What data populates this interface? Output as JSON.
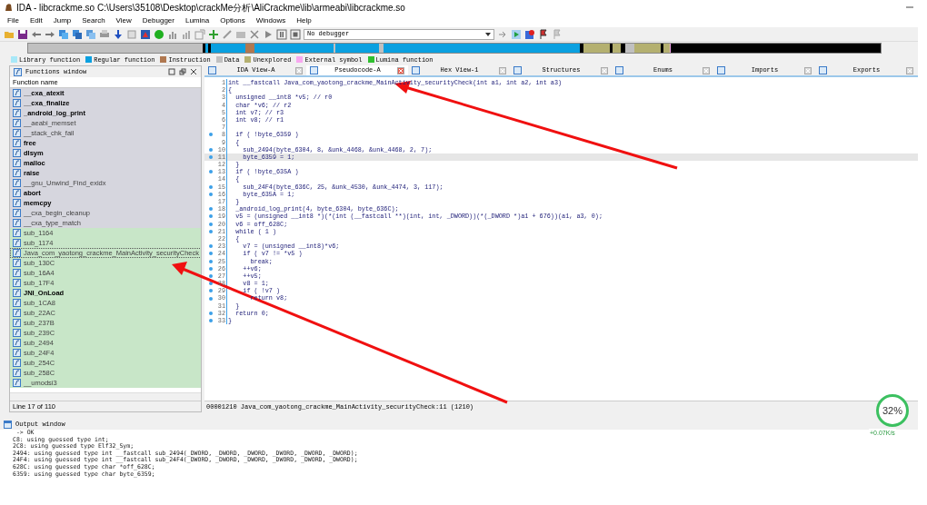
{
  "window": {
    "title": "IDA - libcrackme.so C:\\Users\\35108\\Desktop\\crackMe分析\\AliCrackme\\lib\\armeabi\\libcrackme.so"
  },
  "menu": [
    "File",
    "Edit",
    "Jump",
    "Search",
    "View",
    "Debugger",
    "Lumina",
    "Options",
    "Windows",
    "Help"
  ],
  "toolbar": {
    "debugger_select": "No debugger"
  },
  "legend": [
    {
      "label": "Library function",
      "color": "#a8e8f8"
    },
    {
      "label": "Regular function",
      "color": "#0aa0e0"
    },
    {
      "label": "Instruction",
      "color": "#b07850"
    },
    {
      "label": "Data",
      "color": "#c0c0c0"
    },
    {
      "label": "Unexplored",
      "color": "#b4b070"
    },
    {
      "label": "External symbol",
      "color": "#f8a8f0"
    },
    {
      "label": "Lumina function",
      "color": "#30c030"
    }
  ],
  "functions_window": {
    "title": "Functions window",
    "column": "Function name",
    "status": "Line 17 of 110",
    "items": [
      {
        "name": "__cxa_atexit",
        "bold": true,
        "color": "#d6d6de",
        "selected": false
      },
      {
        "name": "__cxa_finalize",
        "bold": true,
        "color": "#d6d6de",
        "selected": false
      },
      {
        "name": "_android_log_print",
        "bold": true,
        "color": "#d6d6de",
        "selected": false
      },
      {
        "name": "__aeabi_memset",
        "bold": false,
        "color": "#d6d6de",
        "selected": false
      },
      {
        "name": "__stack_chk_fail",
        "bold": false,
        "color": "#d6d6de",
        "selected": false
      },
      {
        "name": "free",
        "bold": true,
        "color": "#d6d6de",
        "selected": false
      },
      {
        "name": "dlsym",
        "bold": true,
        "color": "#d6d6de",
        "selected": false
      },
      {
        "name": "malloc",
        "bold": true,
        "color": "#d6d6de",
        "selected": false
      },
      {
        "name": "raise",
        "bold": true,
        "color": "#d6d6de",
        "selected": false
      },
      {
        "name": "__gnu_Unwind_Find_exidx",
        "bold": false,
        "color": "#d6d6de",
        "selected": false
      },
      {
        "name": "abort",
        "bold": true,
        "color": "#d6d6de",
        "selected": false
      },
      {
        "name": "memcpy",
        "bold": true,
        "color": "#d6d6de",
        "selected": false
      },
      {
        "name": "__cxa_begin_cleanup",
        "bold": false,
        "color": "#d6d6de",
        "selected": false
      },
      {
        "name": "__cxa_type_match",
        "bold": false,
        "color": "#d6d6de",
        "selected": false
      },
      {
        "name": "sub_1164",
        "bold": false,
        "color": "#c8e6c8",
        "selected": false
      },
      {
        "name": "sub_1174",
        "bold": false,
        "color": "#c8e6c8",
        "selected": false
      },
      {
        "name": "Java_com_yaotong_crackme_MainActivity_securityCheck",
        "bold": false,
        "color": "#c8e6c8",
        "selected": true
      },
      {
        "name": "sub_130C",
        "bold": false,
        "color": "#c8e6c8",
        "selected": false
      },
      {
        "name": "sub_16A4",
        "bold": false,
        "color": "#c8e6c8",
        "selected": false
      },
      {
        "name": "sub_17F4",
        "bold": false,
        "color": "#c8e6c8",
        "selected": false
      },
      {
        "name": "JNI_OnLoad",
        "bold": true,
        "color": "#c8e6c8",
        "selected": false
      },
      {
        "name": "sub_1CA8",
        "bold": false,
        "color": "#c8e6c8",
        "selected": false
      },
      {
        "name": "sub_22AC",
        "bold": false,
        "color": "#c8e6c8",
        "selected": false
      },
      {
        "name": "sub_237B",
        "bold": false,
        "color": "#c8e6c8",
        "selected": false
      },
      {
        "name": "sub_239C",
        "bold": false,
        "color": "#c8e6c8",
        "selected": false
      },
      {
        "name": "sub_2494",
        "bold": false,
        "color": "#c8e6c8",
        "selected": false
      },
      {
        "name": "sub_24F4",
        "bold": false,
        "color": "#c8e6c8",
        "selected": false
      },
      {
        "name": "sub_254C",
        "bold": false,
        "color": "#c8e6c8",
        "selected": false
      },
      {
        "name": "sub_258C",
        "bold": false,
        "color": "#c8e6c8",
        "selected": false
      },
      {
        "name": "__umodsi3",
        "bold": false,
        "color": "#c8e6c8",
        "selected": false
      }
    ]
  },
  "tabs": [
    {
      "label": "IDA View-A",
      "selected": false
    },
    {
      "label": "Pseudocode-A",
      "selected": true
    },
    {
      "label": "Hex View-1",
      "selected": false
    },
    {
      "label": "Structures",
      "selected": false
    },
    {
      "label": "Enums",
      "selected": false
    },
    {
      "label": "Imports",
      "selected": false
    },
    {
      "label": "Exports",
      "selected": false
    }
  ],
  "pseudocode": {
    "status": "00001210 Java_com_yaotong_crackme_MainActivity_securityCheck:11 (1210)",
    "lines": [
      {
        "number": "1",
        "text": "int __fastcall Java_com_yaotong_crackme_MainActivity_securityCheck(int a1, int a2, int a3)",
        "breakpoint": false,
        "current": false
      },
      {
        "number": "2",
        "text": "{",
        "breakpoint": false,
        "current": false
      },
      {
        "number": "3",
        "text": "  unsigned __int8 *v5; // r0",
        "breakpoint": false,
        "current": false
      },
      {
        "number": "4",
        "text": "  char *v6; // r2",
        "breakpoint": false,
        "current": false
      },
      {
        "number": "5",
        "text": "  int v7; // r3",
        "breakpoint": false,
        "current": false
      },
      {
        "number": "6",
        "text": "  int v8; // r1",
        "breakpoint": false,
        "current": false
      },
      {
        "number": "7",
        "breakpoint": false,
        "current": false
      },
      {
        "number": "8",
        "text": "  if ( !byte_6359 )",
        "breakpoint": true,
        "current": false
      },
      {
        "number": "9",
        "text": "  {",
        "breakpoint": false,
        "current": false
      },
      {
        "number": "10",
        "text": "    sub_2494(byte_6304, 8, &unk_4468, &unk_4468, 2, 7);",
        "breakpoint": true,
        "current": false
      },
      {
        "number": "11",
        "text": "    byte_6359 = 1;",
        "breakpoint": true,
        "current": true
      },
      {
        "number": "12",
        "text": "  }",
        "breakpoint": false,
        "current": false
      },
      {
        "number": "13",
        "text": "  if ( !byte_635A )",
        "breakpoint": true,
        "current": false
      },
      {
        "number": "14",
        "text": "  {",
        "breakpoint": false,
        "current": false
      },
      {
        "number": "15",
        "text": "    sub_24F4(byte_636C, 25, &unk_4530, &unk_4474, 3, 117);",
        "breakpoint": true,
        "current": false
      },
      {
        "number": "16",
        "text": "    byte_635A = 1;",
        "breakpoint": true,
        "current": false
      },
      {
        "number": "17",
        "text": "  }",
        "breakpoint": false,
        "current": false
      },
      {
        "number": "18",
        "text": "  _android_log_print(4, byte_6304, byte_636C);",
        "breakpoint": true,
        "current": false
      },
      {
        "number": "19",
        "text": "  v5 = (unsigned __int8 *)(*(int (__fastcall **)(int, int, _DWORD))(*(_DWORD *)a1 + 676))(a1, a3, 0);",
        "breakpoint": true,
        "current": false
      },
      {
        "number": "20",
        "text": "  v6 = off_628C;",
        "breakpoint": true,
        "current": false
      },
      {
        "number": "21",
        "text": "  while ( 1 )",
        "breakpoint": true,
        "current": false
      },
      {
        "number": "22",
        "text": "  {",
        "breakpoint": false,
        "current": false
      },
      {
        "number": "23",
        "text": "    v7 = (unsigned __int8)*v6;",
        "breakpoint": true,
        "current": false
      },
      {
        "number": "24",
        "text": "    if ( v7 != *v5 )",
        "breakpoint": true,
        "current": false
      },
      {
        "number": "25",
        "text": "      break;",
        "breakpoint": true,
        "current": false
      },
      {
        "number": "26",
        "text": "    ++v6;",
        "breakpoint": true,
        "current": false
      },
      {
        "number": "27",
        "text": "    ++v5;",
        "breakpoint": true,
        "current": false
      },
      {
        "number": "28",
        "text": "    v8 = 1;",
        "breakpoint": true,
        "current": false
      },
      {
        "number": "29",
        "text": "    if ( !v7 )",
        "breakpoint": true,
        "current": false
      },
      {
        "number": "30",
        "text": "      return v8;",
        "breakpoint": true,
        "current": false
      },
      {
        "number": "31",
        "text": "  }",
        "breakpoint": false,
        "current": false
      },
      {
        "number": "32",
        "text": "  return 0;",
        "breakpoint": true,
        "current": false
      },
      {
        "number": "33",
        "text": "}",
        "breakpoint": true,
        "current": false
      }
    ]
  },
  "output_window": {
    "title": "Output window",
    "lines": [
      " -> OK",
      "C8: using guessed type int;",
      "2C8: using guessed type Elf32_Sym;",
      "2494: using guessed type int __fastcall sub_2494(_DWORD, _DWORD, _DWORD, _DWORD, _DWORD, _DWORD);",
      "24F4: using guessed type int __fastcall sub_24F4(_DWORD, _DWORD, _DWORD, _DWORD, _DWORD, _DWORD);",
      "628C: using guessed type char *off_628C;",
      "6359: using guessed type char byte_6359;"
    ]
  },
  "speed_meter": {
    "percent": "32%",
    "rate": "+0.07K/s"
  }
}
